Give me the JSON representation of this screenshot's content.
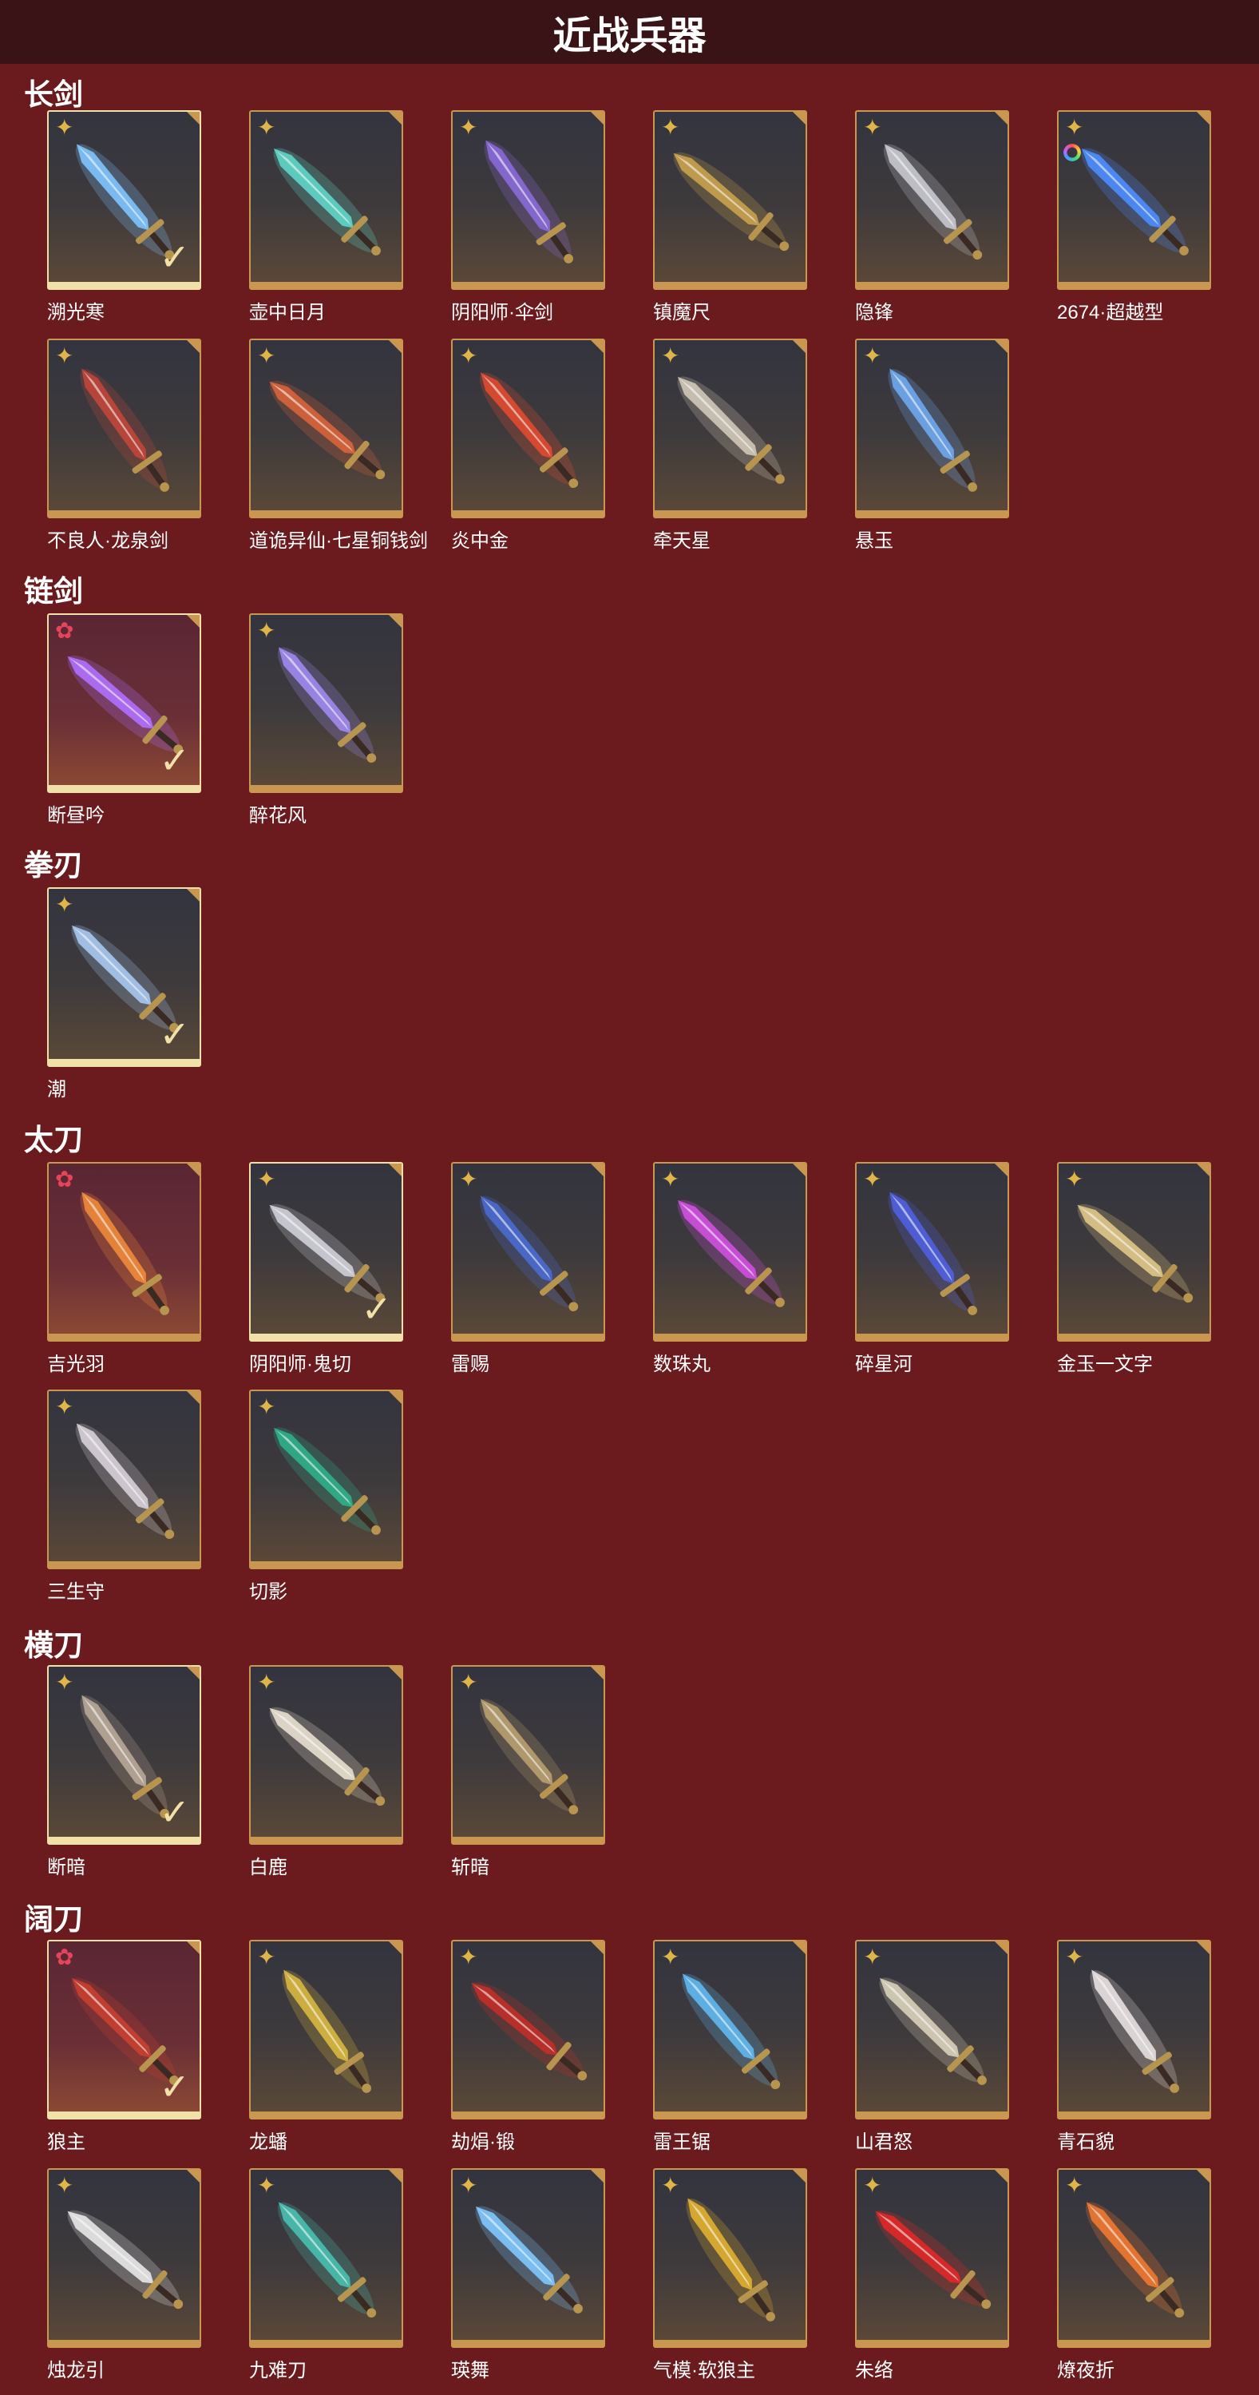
{
  "page_title": "近战兵器",
  "sections": [
    {
      "title": "长剑",
      "items": [
        {
          "name": "溯光寒",
          "rank": "gold",
          "selected": true,
          "tint": "",
          "color": "#7fc4ff",
          "ring": false
        },
        {
          "name": "壶中日月",
          "rank": "gold",
          "selected": false,
          "tint": "",
          "color": "#5fd6c8",
          "ring": false
        },
        {
          "name": "阴阳师·伞剑",
          "rank": "gold",
          "selected": false,
          "tint": "",
          "color": "#8a6ad8",
          "ring": false
        },
        {
          "name": "镇魔尺",
          "rank": "gold",
          "selected": false,
          "tint": "",
          "color": "#c9a24e",
          "ring": false
        },
        {
          "name": "隐锋",
          "rank": "gold",
          "selected": false,
          "tint": "",
          "color": "#c8c8d0",
          "ring": false
        },
        {
          "name": "2674·超越型",
          "rank": "gold",
          "selected": false,
          "tint": "",
          "color": "#4d8dff",
          "ring": true
        },
        {
          "name": "不良人·龙泉剑",
          "rank": "gold",
          "selected": false,
          "tint": "",
          "color": "#c0463a",
          "ring": false
        },
        {
          "name": "道诡异仙·七星铜钱剑",
          "rank": "gold",
          "selected": false,
          "tint": "",
          "color": "#d8643a",
          "ring": false
        },
        {
          "name": "炎中金",
          "rank": "gold",
          "selected": false,
          "tint": "",
          "color": "#e04a30",
          "ring": false
        },
        {
          "name": "牵天星",
          "rank": "gold",
          "selected": false,
          "tint": "",
          "color": "#d0c8b8",
          "ring": false
        },
        {
          "name": "悬玉",
          "rank": "gold",
          "selected": false,
          "tint": "",
          "color": "#6ea8f0",
          "ring": false
        }
      ]
    },
    {
      "title": "链剑",
      "items": [
        {
          "name": "断昼吟",
          "rank": "red",
          "selected": true,
          "tint": "red",
          "color": "#b070ff",
          "ring": false
        },
        {
          "name": "醉花风",
          "rank": "gold",
          "selected": false,
          "tint": "",
          "color": "#a08af0",
          "ring": false
        }
      ]
    },
    {
      "title": "拳刃",
      "items": [
        {
          "name": "潮",
          "rank": "gold",
          "selected": true,
          "tint": "",
          "color": "#a8c8f0",
          "ring": false
        }
      ]
    },
    {
      "title": "太刀",
      "items": [
        {
          "name": "吉光羽",
          "rank": "red",
          "selected": false,
          "tint": "red",
          "color": "#f08a3a",
          "ring": false
        },
        {
          "name": "阴阳师·鬼切",
          "rank": "gold",
          "selected": true,
          "tint": "",
          "color": "#d0d0d8",
          "ring": false
        },
        {
          "name": "雷赐",
          "rank": "gold",
          "selected": false,
          "tint": "",
          "color": "#4a6ad0",
          "ring": false
        },
        {
          "name": "数珠丸",
          "rank": "gold",
          "selected": false,
          "tint": "",
          "color": "#d050e0",
          "ring": false
        },
        {
          "name": "碎星河",
          "rank": "gold",
          "selected": false,
          "tint": "",
          "color": "#5060e0",
          "ring": false
        },
        {
          "name": "金玉一文字",
          "rank": "gold",
          "selected": false,
          "tint": "",
          "color": "#e0c888",
          "ring": false
        },
        {
          "name": "三生守",
          "rank": "gold",
          "selected": false,
          "tint": "",
          "color": "#d8d0d8",
          "ring": false
        },
        {
          "name": "切影",
          "rank": "gold",
          "selected": false,
          "tint": "",
          "color": "#2fb08a",
          "ring": false
        }
      ]
    },
    {
      "title": "横刀",
      "items": [
        {
          "name": "断暗",
          "rank": "gold",
          "selected": true,
          "tint": "",
          "color": "#b8a898",
          "ring": false
        },
        {
          "name": "白鹿",
          "rank": "gold",
          "selected": false,
          "tint": "",
          "color": "#e8e0d0",
          "ring": false
        },
        {
          "name": "斩暗",
          "rank": "gold",
          "selected": false,
          "tint": "",
          "color": "#b8a070",
          "ring": false
        }
      ]
    },
    {
      "title": "阔刀",
      "items": [
        {
          "name": "狼主",
          "rank": "red",
          "selected": true,
          "tint": "red",
          "color": "#c84030",
          "ring": false
        },
        {
          "name": "龙蟠",
          "rank": "gold",
          "selected": false,
          "tint": "",
          "color": "#d8b840",
          "ring": false
        },
        {
          "name": "劫焆·锻",
          "rank": "gold",
          "selected": false,
          "tint": "",
          "color": "#c03028",
          "ring": false
        },
        {
          "name": "雷王锯",
          "rank": "gold",
          "selected": false,
          "tint": "",
          "color": "#60b8f0",
          "ring": false
        },
        {
          "name": "山君怒",
          "rank": "gold",
          "selected": false,
          "tint": "",
          "color": "#d8d0b8",
          "ring": false
        },
        {
          "name": "青石貌",
          "rank": "gold",
          "selected": false,
          "tint": "",
          "color": "#e8e0e0",
          "ring": false
        },
        {
          "name": "烛龙引",
          "rank": "gold",
          "selected": false,
          "tint": "",
          "color": "#e8e8e8",
          "ring": false
        },
        {
          "name": "九难刀",
          "rank": "gold",
          "selected": false,
          "tint": "",
          "color": "#48c0b0",
          "ring": false
        },
        {
          "name": "瑛舞",
          "rank": "gold",
          "selected": false,
          "tint": "",
          "color": "#80c8ff",
          "ring": false
        },
        {
          "name": "气模·软狼主",
          "rank": "gold",
          "selected": false,
          "tint": "",
          "color": "#e0b030",
          "ring": false
        },
        {
          "name": "朱络",
          "rank": "gold",
          "selected": false,
          "tint": "",
          "color": "#e02828",
          "ring": false
        },
        {
          "name": "燎夜折",
          "rank": "gold",
          "selected": false,
          "tint": "",
          "color": "#f07830",
          "ring": false
        }
      ]
    }
  ]
}
